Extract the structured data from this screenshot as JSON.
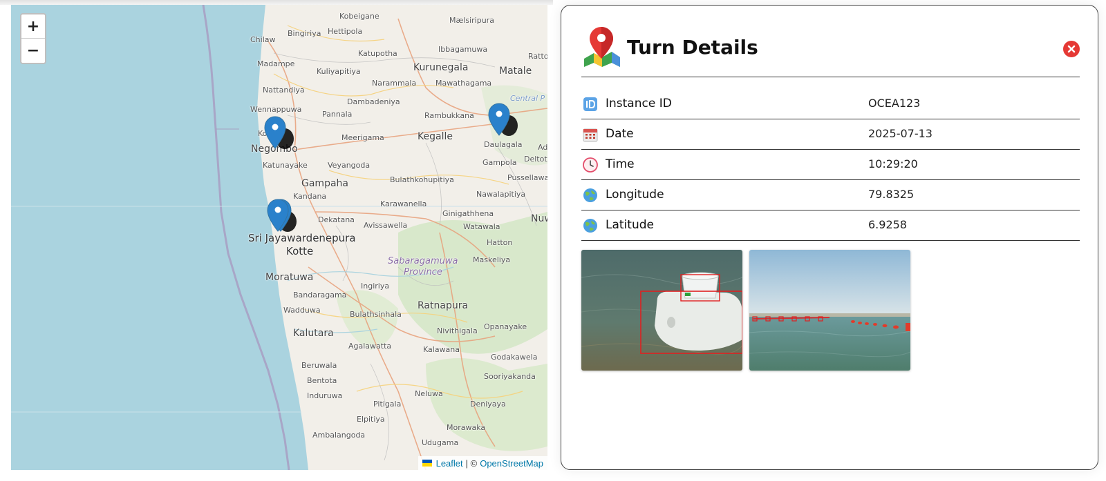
{
  "map": {
    "zoom_in": "+",
    "zoom_out": "−",
    "attribution": {
      "leaflet": "Leaflet",
      "separator": "| ©",
      "osm": "OpenStreetMap"
    },
    "places": [
      {
        "name": "Kobeigane"
      },
      {
        "name": "Mælsiripura"
      },
      {
        "name": "Chilaw"
      },
      {
        "name": "Bingiriya"
      },
      {
        "name": "Hettipola"
      },
      {
        "name": "Katupotha"
      },
      {
        "name": "Ibbagamuwa"
      },
      {
        "name": "Rattota"
      },
      {
        "name": "Madampe"
      },
      {
        "name": "Kuliyapitiya"
      },
      {
        "name": "Kurunegala"
      },
      {
        "name": "Matale"
      },
      {
        "name": "Narammala"
      },
      {
        "name": "Mawathagama"
      },
      {
        "name": "Nattandiya"
      },
      {
        "name": "Central P"
      },
      {
        "name": "Dambadeniya"
      },
      {
        "name": "Wennappuwa"
      },
      {
        "name": "Pannala"
      },
      {
        "name": "Rambukkana"
      },
      {
        "name": "Ko"
      },
      {
        "name": "Meerigama"
      },
      {
        "name": "Kegalle"
      },
      {
        "name": "Daulagala"
      },
      {
        "name": "Ad"
      },
      {
        "name": "Negombo"
      },
      {
        "name": "Katunayake"
      },
      {
        "name": "Veyangoda"
      },
      {
        "name": "Gampola"
      },
      {
        "name": "Deltot"
      },
      {
        "name": "Gampaha"
      },
      {
        "name": "Bulathkohupitiya"
      },
      {
        "name": "Pussellawa"
      },
      {
        "name": "Kandana"
      },
      {
        "name": "Nawalapitiya"
      },
      {
        "name": "Karawanella"
      },
      {
        "name": "Ginigathhena"
      },
      {
        "name": "Dekatana"
      },
      {
        "name": "Watawala"
      },
      {
        "name": "Nuw"
      },
      {
        "name": "Avissawella"
      },
      {
        "name": "Sri Jayawardenepura"
      },
      {
        "name": "Kotte"
      },
      {
        "name": "Hatton"
      },
      {
        "name": "Sabaragamuwa"
      },
      {
        "name": "Province"
      },
      {
        "name": "Maskeliya"
      },
      {
        "name": "Moratuwa"
      },
      {
        "name": "Ingiriya"
      },
      {
        "name": "Bandaragama"
      },
      {
        "name": "Ratnapura"
      },
      {
        "name": "Wadduwa"
      },
      {
        "name": "Bulathsinhala"
      },
      {
        "name": "Opanayake"
      },
      {
        "name": "Nivithigala"
      },
      {
        "name": "Kalutara"
      },
      {
        "name": "Agalawatta"
      },
      {
        "name": "Kalawana"
      },
      {
        "name": "Godakawela"
      },
      {
        "name": "Beruwala"
      },
      {
        "name": "Sooriyakanda"
      },
      {
        "name": "Bentota"
      },
      {
        "name": "Induruwa"
      },
      {
        "name": "Neluwa"
      },
      {
        "name": "Pitigala"
      },
      {
        "name": "Deniyaya"
      },
      {
        "name": "Elpitiya"
      },
      {
        "name": "Morawaka"
      },
      {
        "name": "Ambalangoda"
      },
      {
        "name": "Udugama"
      }
    ]
  },
  "panel": {
    "title": "Turn Details",
    "rows": [
      {
        "label": "Instance ID",
        "value": "OCEA123",
        "icon": "id-icon"
      },
      {
        "label": "Date",
        "value": "2025-07-13",
        "icon": "calendar-icon"
      },
      {
        "label": "Time",
        "value": "10:29:20",
        "icon": "clock-icon"
      },
      {
        "label": "Longitude",
        "value": "79.8325",
        "icon": "globe-icon"
      },
      {
        "label": "Latitude",
        "value": "6.9258",
        "icon": "globe-icon"
      }
    ],
    "images": [
      {
        "icon": "detection-photo-bottle"
      },
      {
        "icon": "detection-photo-buoys"
      }
    ]
  },
  "colors": {
    "sea": "#aad3df",
    "marker": "#2a81cb",
    "close": "#e53935",
    "link": "#0078a8"
  }
}
